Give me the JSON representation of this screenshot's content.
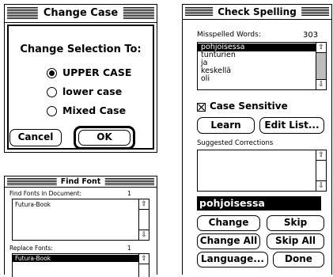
{
  "change_case": {
    "title": "Change Case",
    "heading": "Change Selection To:",
    "options": [
      {
        "label": "UPPER CASE",
        "selected": true
      },
      {
        "label": "lower case",
        "selected": false
      },
      {
        "label": "Mixed Case",
        "selected": false
      }
    ],
    "cancel_label": "Cancel",
    "ok_label": "OK"
  },
  "find_font": {
    "title": "Find Font",
    "fonts_in_doc_label": "Find Fonts in Document:",
    "fonts_in_doc_count": "1",
    "fonts_in_doc": [
      "Futura-Book"
    ],
    "replace_label": "Replace Fonts:",
    "replace_count": "1",
    "replace_fonts": [
      "Futura-Book"
    ]
  },
  "check_spelling": {
    "title": "Check Spelling",
    "misspelled_label": "Misspelled Words:",
    "misspelled_count": "303",
    "words": [
      "pohjoisessa",
      "tunturien",
      "ja",
      "keskellä",
      "oli"
    ],
    "case_sensitive_label": "Case Sensitive",
    "case_sensitive_checked": true,
    "learn_label": "Learn",
    "edit_list_label": "Edit List...",
    "suggested_label": "Suggested Corrections",
    "current_word": "pohjoisessa",
    "change_label": "Change",
    "skip_label": "Skip",
    "change_all_label": "Change All",
    "skip_all_label": "Skip All",
    "language_label": "Language...",
    "done_label": "Done"
  }
}
